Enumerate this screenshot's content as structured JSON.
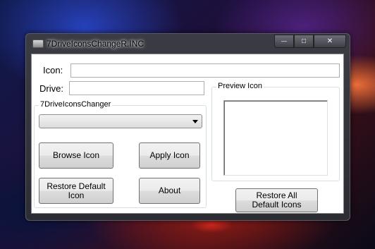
{
  "window": {
    "title": "7DriveIconsChangeR.INC",
    "controls": {
      "minimize": "—",
      "maximize": "□",
      "close": "✕"
    }
  },
  "form": {
    "icon_label": "Icon:",
    "icon_value": "",
    "drive_label": "Drive:",
    "drive_value": "",
    "group_caption": "7DriveIconsChanger",
    "drive_select_value": "",
    "browse_button": "Browse Icon",
    "apply_button": "Apply Icon",
    "restore_default_button": "Restore Default Icon",
    "about_button": "About",
    "preview_caption": "Preview Icon",
    "restore_all_button": "Restore All Default Icons"
  },
  "icons": {
    "app": "drive-icon",
    "dropdown": "chevron-down-icon"
  }
}
